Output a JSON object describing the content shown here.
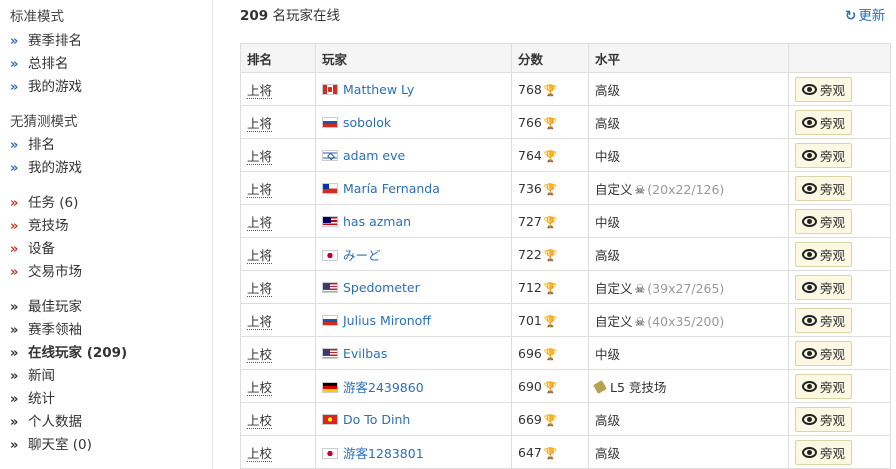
{
  "sidebar": {
    "sections": [
      {
        "title": "标准模式",
        "items": [
          {
            "label": "赛季排名"
          },
          {
            "label": "总排名"
          },
          {
            "label": "我的游戏"
          }
        ]
      },
      {
        "title": "无猜测模式",
        "items": [
          {
            "label": "排名"
          },
          {
            "label": "我的游戏"
          }
        ]
      }
    ],
    "group2": [
      {
        "label": "任务 (6)"
      },
      {
        "label": "竞技场"
      },
      {
        "label": "设备"
      },
      {
        "label": "交易市场"
      }
    ],
    "group3": [
      {
        "label": "最佳玩家"
      },
      {
        "label": "赛季领袖"
      },
      {
        "label": "在线玩家 (209)"
      },
      {
        "label": "新闻"
      },
      {
        "label": "统计"
      },
      {
        "label": "个人数据"
      },
      {
        "label": "聊天室 (0)"
      }
    ]
  },
  "header": {
    "count": "209",
    "online_label": "名玩家在线",
    "refresh_label": "更新"
  },
  "table": {
    "columns": [
      "排名",
      "玩家",
      "分数",
      "水平",
      ""
    ],
    "rows": [
      {
        "rank": "上将",
        "flag": "CA",
        "name": "Matthew Ly",
        "score": "768",
        "level": "高级",
        "dims": "",
        "watch": "旁观"
      },
      {
        "rank": "上将",
        "flag": "RU",
        "name": "sobolok",
        "score": "766",
        "level": "高级",
        "dims": "",
        "watch": "旁观"
      },
      {
        "rank": "上将",
        "flag": "IL",
        "name": "adam eve",
        "score": "764",
        "level": "中级",
        "dims": "",
        "watch": "旁观"
      },
      {
        "rank": "上将",
        "flag": "CL",
        "name": "María Fernanda",
        "score": "736",
        "level": "自定义",
        "dims": "(20x22/126)",
        "watch": "旁观"
      },
      {
        "rank": "上将",
        "flag": "MY",
        "name": "has azman",
        "score": "727",
        "level": "中级",
        "dims": "",
        "watch": "旁观"
      },
      {
        "rank": "上将",
        "flag": "JP",
        "name": "みーど",
        "score": "722",
        "level": "高级",
        "dims": "",
        "watch": "旁观"
      },
      {
        "rank": "上将",
        "flag": "US",
        "name": "Spedometer",
        "score": "712",
        "level": "自定义",
        "dims": "(39x27/265)",
        "watch": "旁观"
      },
      {
        "rank": "上将",
        "flag": "RU",
        "name": "Julius Mironoff",
        "score": "701",
        "level": "自定义",
        "dims": "(40x35/200)",
        "watch": "旁观"
      },
      {
        "rank": "上校",
        "flag": "US",
        "name": "Evilbas",
        "score": "696",
        "level": "中级",
        "dims": "",
        "watch": "旁观"
      },
      {
        "rank": "上校",
        "flag": "DE",
        "name": "游客2439860",
        "score": "690",
        "level": "L5 竞技场",
        "dims": "",
        "watch": "旁观"
      },
      {
        "rank": "上校",
        "flag": "VN",
        "name": "Do To Dinh",
        "score": "669",
        "level": "高级",
        "dims": "",
        "watch": "旁观"
      },
      {
        "rank": "上校",
        "flag": "JP",
        "name": "游客1283801",
        "score": "647",
        "level": "高级",
        "dims": "",
        "watch": "旁观"
      }
    ]
  },
  "colors": {
    "link": "#2b6fb6",
    "trophy": "#e09b1a",
    "nav_red": "#c0392b"
  }
}
